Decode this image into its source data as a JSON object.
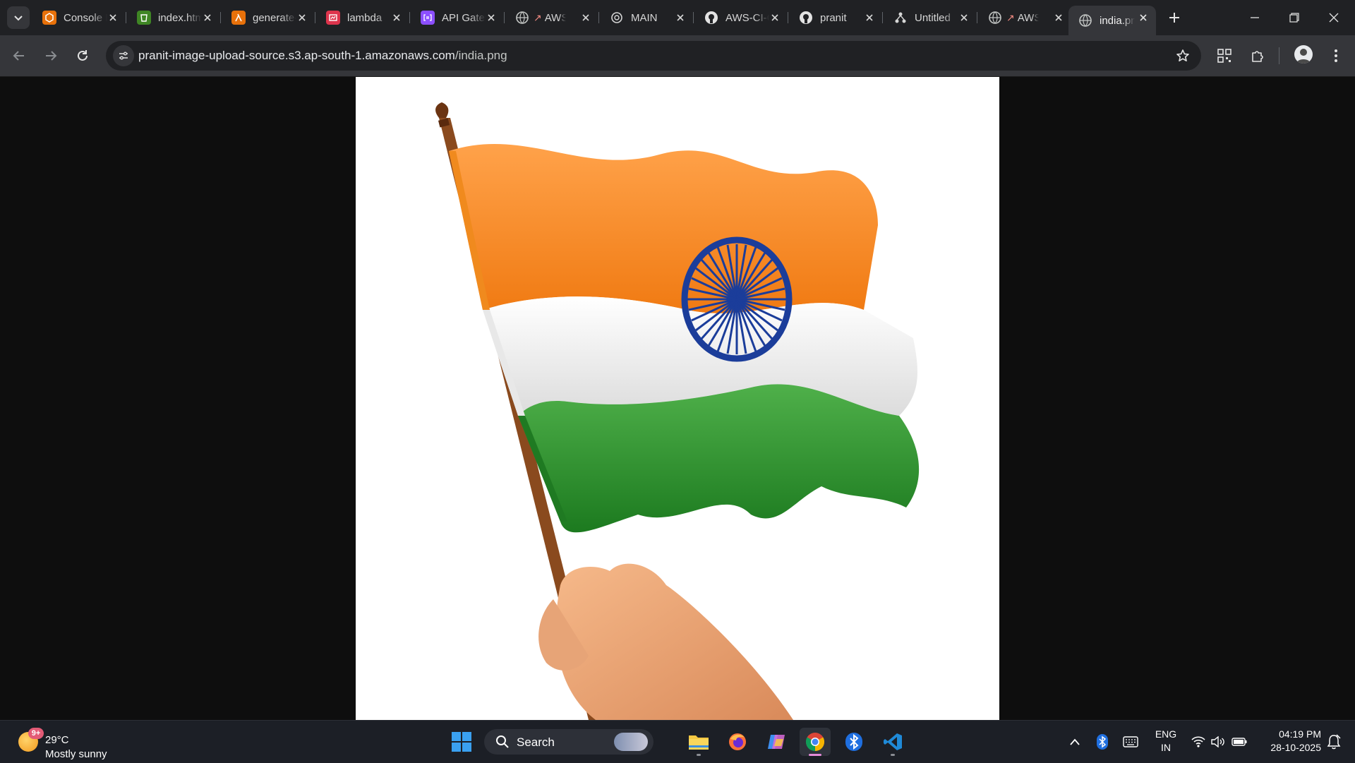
{
  "browser": {
    "tabs": [
      {
        "title": "Console Home",
        "favicon": "aws-console-icon",
        "color": "#e8710a"
      },
      {
        "title": "index.html",
        "favicon": "s3-bucket-icon",
        "color": "#3f8624"
      },
      {
        "title": "generate-thumbnail",
        "favicon": "lambda-icon",
        "color": "#e8710a"
      },
      {
        "title": "lambda",
        "favicon": "cloudwatch-icon",
        "color": "#dd344c"
      },
      {
        "title": "API Gateway",
        "favicon": "api-gateway-icon",
        "color": "#8c4fff"
      },
      {
        "title": "AWS",
        "favicon": "globe-rocket-icon",
        "color": "#9aa0a6"
      },
      {
        "title": "MAIN",
        "favicon": "chatgpt-icon",
        "color": "#9aa0a6"
      },
      {
        "title": "AWS-CI-CD",
        "favicon": "github-icon",
        "color": "#e3e3e3"
      },
      {
        "title": "pranit",
        "favicon": "github-icon",
        "color": "#e3e3e3"
      },
      {
        "title": "Untitled",
        "favicon": "diagram-icon",
        "color": "#e3e3e3"
      },
      {
        "title": "AWS",
        "favicon": "globe-rocket-icon",
        "color": "#9aa0a6"
      },
      {
        "title": "india.png",
        "favicon": "globe-icon",
        "color": "#9aa0a6",
        "active": true
      }
    ],
    "address": {
      "host": "pranit-image-upload-source.s3.ap-south-1.amazonaws.com",
      "path": "/india.png"
    }
  },
  "taskbar": {
    "weather": {
      "badge": "9+",
      "temp": "29°C",
      "condition": "Mostly sunny"
    },
    "search_label": "Search",
    "apps": [
      "windows-start",
      "search",
      "task-view",
      "file-explorer",
      "firefox",
      "copilot",
      "chrome",
      "bluetooth",
      "vscode"
    ],
    "language": {
      "line1": "ENG",
      "line2": "IN"
    },
    "time": "04:19 PM",
    "date": "28-10-2025"
  }
}
